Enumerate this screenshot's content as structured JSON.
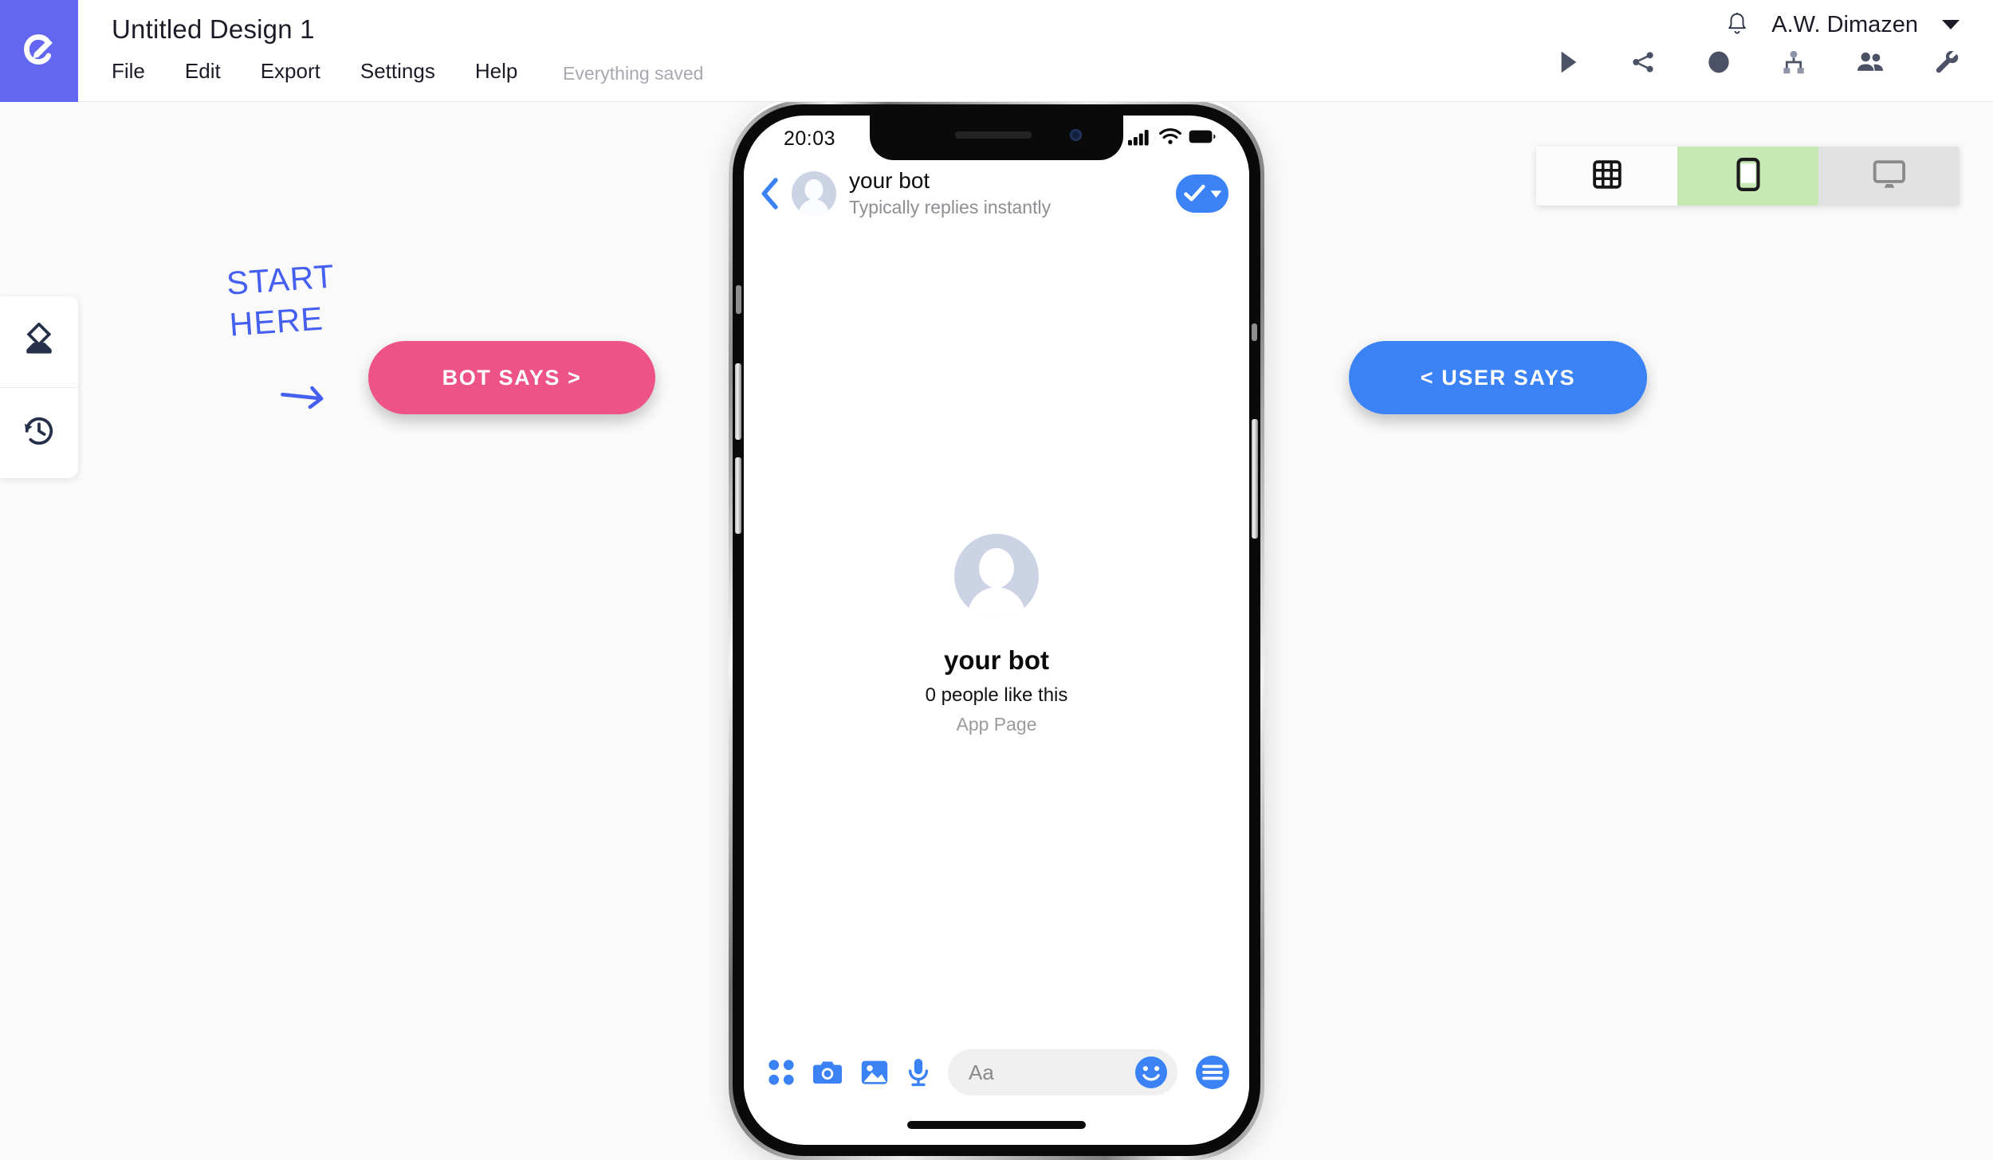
{
  "app": {
    "logo_icon": "pencil-circle-logo",
    "brand_color": "#6366f1"
  },
  "topbar": {
    "document_title": "Untitled Design 1",
    "menu": [
      {
        "label": "File",
        "name": "menu-file"
      },
      {
        "label": "Edit",
        "name": "menu-edit"
      },
      {
        "label": "Export",
        "name": "menu-export"
      },
      {
        "label": "Settings",
        "name": "menu-settings"
      },
      {
        "label": "Help",
        "name": "menu-help"
      }
    ],
    "save_status": "Everything saved",
    "notifications_icon": "bell-icon",
    "account_name": "A.W. Dimazen",
    "account_caret_icon": "chevron-down-icon",
    "actions": [
      {
        "name": "play-button",
        "icon": "play-icon"
      },
      {
        "name": "share-button",
        "icon": "share-icon"
      },
      {
        "name": "record-button",
        "icon": "circle-icon"
      },
      {
        "name": "flow-button",
        "icon": "sitemap-icon"
      },
      {
        "name": "audience-button",
        "icon": "people-icon"
      },
      {
        "name": "settings-button",
        "icon": "wrench-icon"
      }
    ]
  },
  "sidebar": {
    "tools": [
      {
        "name": "sidebar-tool-erase",
        "icon": "eraser-icon"
      },
      {
        "name": "sidebar-tool-history",
        "icon": "history-clock-icon"
      }
    ]
  },
  "view_toggle": {
    "options": [
      {
        "name": "view-mode-grid",
        "icon": "grid-icon",
        "active": false
      },
      {
        "name": "view-mode-mobile",
        "icon": "mobile-icon",
        "active": true
      },
      {
        "name": "view-mode-desktop",
        "icon": "desktop-icon",
        "active": false
      }
    ],
    "active_color": "#c6e8b5"
  },
  "canvas": {
    "hint_line1": "START",
    "hint_line2": "HERE",
    "hint_color": "#4560f0",
    "hint_arrow_icon": "arrow-right-icon",
    "bot_says_label": "BOT SAYS >",
    "bot_says_color": "#ed5386",
    "user_says_label": "< USER SAYS",
    "user_says_color": "#3b82f6"
  },
  "phone": {
    "status_bar": {
      "time": "20:03",
      "signal_icon": "cellular-signal-icon",
      "wifi_icon": "wifi-icon",
      "battery_icon": "battery-full-icon"
    },
    "chat_header": {
      "back_icon": "chevron-left-icon",
      "avatar_icon": "person-avatar",
      "name": "your bot",
      "subtitle": "Typically replies instantly",
      "action_icon": "check-dropdown-icon"
    },
    "profile": {
      "avatar_icon": "person-avatar",
      "name": "your bot",
      "likes": "0 people like this",
      "page_type": "App Page"
    },
    "composer": {
      "icons": [
        {
          "name": "composer-apps-button",
          "icon": "four-dots-icon"
        },
        {
          "name": "composer-camera-button",
          "icon": "camera-icon"
        },
        {
          "name": "composer-gallery-button",
          "icon": "image-icon"
        },
        {
          "name": "composer-mic-button",
          "icon": "microphone-icon"
        }
      ],
      "placeholder": "Aa",
      "emoji_icon": "smiley-icon",
      "menu_icon": "hamburger-circle-icon"
    }
  }
}
